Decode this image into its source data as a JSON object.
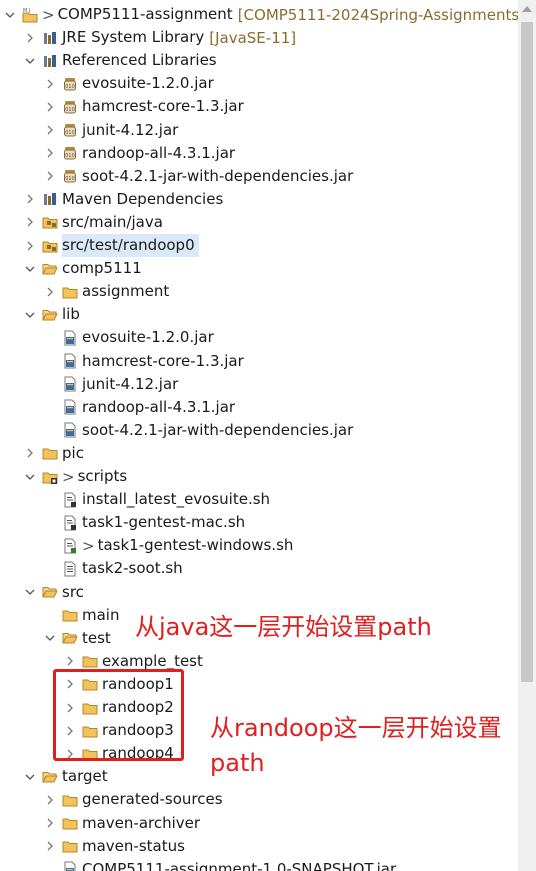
{
  "tree": {
    "rows": [
      {
        "depth": 0,
        "twisty": "expanded",
        "icon": "maven-project-icon",
        "label": "COMP5111-assignment",
        "prefix": ">",
        "decoration": "[COMP5111-2024Spring-Assignments-"
      },
      {
        "depth": 1,
        "twisty": "collapsed",
        "icon": "library-icon",
        "label": "JRE System Library",
        "decoration": "[JavaSE-11]"
      },
      {
        "depth": 1,
        "twisty": "expanded",
        "icon": "library-icon",
        "label": "Referenced Libraries"
      },
      {
        "depth": 2,
        "twisty": "collapsed",
        "icon": "jar-icon",
        "label": "evosuite-1.2.0.jar"
      },
      {
        "depth": 2,
        "twisty": "collapsed",
        "icon": "jar-icon",
        "label": "hamcrest-core-1.3.jar"
      },
      {
        "depth": 2,
        "twisty": "collapsed",
        "icon": "jar-icon",
        "label": "junit-4.12.jar"
      },
      {
        "depth": 2,
        "twisty": "collapsed",
        "icon": "jar-icon",
        "label": "randoop-all-4.3.1.jar"
      },
      {
        "depth": 2,
        "twisty": "collapsed",
        "icon": "jar-icon",
        "label": "soot-4.2.1-jar-with-dependencies.jar"
      },
      {
        "depth": 1,
        "twisty": "collapsed",
        "icon": "library-icon",
        "label": "Maven Dependencies"
      },
      {
        "depth": 1,
        "twisty": "collapsed",
        "icon": "source-folder-icon",
        "label": "src/main/java"
      },
      {
        "depth": 1,
        "twisty": "collapsed",
        "icon": "source-folder-icon",
        "label": "src/test/randoop0",
        "selected": true
      },
      {
        "depth": 1,
        "twisty": "expanded",
        "icon": "folder-open-icon",
        "label": "comp5111"
      },
      {
        "depth": 2,
        "twisty": "collapsed",
        "icon": "folder-icon",
        "label": "assignment"
      },
      {
        "depth": 1,
        "twisty": "expanded",
        "icon": "folder-open-icon",
        "label": "lib"
      },
      {
        "depth": 2,
        "twisty": "none",
        "icon": "jar-file-icon",
        "label": "evosuite-1.2.0.jar"
      },
      {
        "depth": 2,
        "twisty": "none",
        "icon": "jar-file-icon",
        "label": "hamcrest-core-1.3.jar"
      },
      {
        "depth": 2,
        "twisty": "none",
        "icon": "jar-file-icon",
        "label": "junit-4.12.jar"
      },
      {
        "depth": 2,
        "twisty": "none",
        "icon": "jar-file-icon",
        "label": "randoop-all-4.3.1.jar"
      },
      {
        "depth": 2,
        "twisty": "none",
        "icon": "jar-file-icon",
        "label": "soot-4.2.1-jar-with-dependencies.jar"
      },
      {
        "depth": 1,
        "twisty": "collapsed",
        "icon": "folder-icon",
        "label": "pic"
      },
      {
        "depth": 1,
        "twisty": "expanded",
        "icon": "folder-modified-icon",
        "label": "scripts",
        "prefix": ">"
      },
      {
        "depth": 2,
        "twisty": "none",
        "icon": "script-file-icon",
        "label": "install_latest_evosuite.sh"
      },
      {
        "depth": 2,
        "twisty": "none",
        "icon": "script-file-icon",
        "label": "task1-gentest-mac.sh"
      },
      {
        "depth": 2,
        "twisty": "none",
        "icon": "script-file-modified-icon",
        "label": "task1-gentest-windows.sh",
        "prefix": ">"
      },
      {
        "depth": 2,
        "twisty": "none",
        "icon": "text-file-icon",
        "label": "task2-soot.sh"
      },
      {
        "depth": 1,
        "twisty": "expanded",
        "icon": "folder-open-icon",
        "label": "src"
      },
      {
        "depth": 2,
        "twisty": "none",
        "icon": "folder-icon",
        "label": "main"
      },
      {
        "depth": 2,
        "twisty": "expanded",
        "icon": "folder-open-icon",
        "label": "test"
      },
      {
        "depth": 3,
        "twisty": "collapsed",
        "icon": "folder-icon",
        "label": "example_test"
      },
      {
        "depth": 3,
        "twisty": "collapsed",
        "icon": "folder-icon",
        "label": "randoop1"
      },
      {
        "depth": 3,
        "twisty": "collapsed",
        "icon": "folder-icon",
        "label": "randoop2"
      },
      {
        "depth": 3,
        "twisty": "collapsed",
        "icon": "folder-icon",
        "label": "randoop3"
      },
      {
        "depth": 3,
        "twisty": "collapsed",
        "icon": "folder-icon",
        "label": "randoop4"
      },
      {
        "depth": 1,
        "twisty": "expanded",
        "icon": "folder-open-icon",
        "label": "target"
      },
      {
        "depth": 2,
        "twisty": "collapsed",
        "icon": "folder-icon",
        "label": "generated-sources"
      },
      {
        "depth": 2,
        "twisty": "collapsed",
        "icon": "folder-icon",
        "label": "maven-archiver"
      },
      {
        "depth": 2,
        "twisty": "collapsed",
        "icon": "folder-icon",
        "label": "maven-status"
      },
      {
        "depth": 2,
        "twisty": "none",
        "icon": "jar-file-icon",
        "label": "COMP5111-assignment-1.0-SNAPSHOT.jar"
      }
    ]
  },
  "annotations": {
    "java_note": "从java这一层开始设置path",
    "randoop_note_line1": "从randoop这一层开始设置",
    "randoop_note_line2": "path"
  },
  "colors": {
    "annotation_red": "#e02020",
    "selection": "#dbe8f7",
    "folder": "#e8b84a",
    "decoration": "#8a6b2f"
  }
}
